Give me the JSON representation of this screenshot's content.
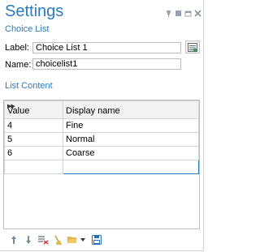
{
  "header": {
    "title": "Settings",
    "subtitle": "Choice List"
  },
  "window_controls": [
    "pin-icon",
    "restore-icon",
    "float-icon",
    "close-icon"
  ],
  "fields": {
    "label": {
      "label": "Label:",
      "value": "Choice List 1"
    },
    "name": {
      "label": "Name:",
      "value": "choicelist1"
    }
  },
  "section": {
    "title": "List Content"
  },
  "table": {
    "columns": [
      "Value",
      "Display name"
    ],
    "rows": [
      {
        "value": "4",
        "display": "Fine"
      },
      {
        "value": "5",
        "display": "Normal"
      },
      {
        "value": "6",
        "display": "Coarse"
      },
      {
        "value": "",
        "display": ""
      }
    ]
  },
  "toolbar": [
    "move-up-icon",
    "move-down-icon",
    "delete-icon",
    "clear-icon",
    "open-folder-icon",
    "dropdown-icon",
    "save-icon"
  ],
  "colors": {
    "accent": "#2a7bbf",
    "border": "#bdbdbd"
  }
}
